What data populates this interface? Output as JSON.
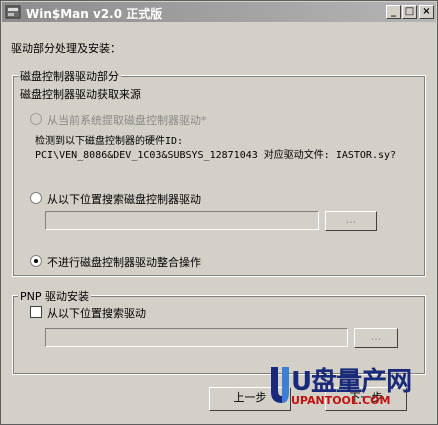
{
  "window": {
    "title": "Win$Man v2.0 正式版"
  },
  "titlebar_buttons": {
    "minimize": "_",
    "maximize": "□",
    "close": "×"
  },
  "intro": "驱动部分处理及安装：",
  "disk_group": {
    "legend": "磁盘控制器驱动部分",
    "source_label": "磁盘控制器驱动获取来源",
    "option_current": "从当前系统提取磁盘控制器驱动*",
    "detected_label": "检测到以下磁盘控制器的硬件ID:",
    "hardware_id_line": "PCI\\VEN_8086&DEV_1C03&SUBSYS_12871043 对应驱动文件: IASTOR.sy?",
    "option_search": "从以下位置搜索磁盘控制器驱动",
    "search_path_value": "",
    "browse_label": "...",
    "option_skip": "不进行磁盘控制器驱动整合操作",
    "selected_option": "option_skip"
  },
  "pnp_group": {
    "legend": "PNP 驱动安装",
    "checkbox_label": "从以下位置搜索驱动",
    "checked": false,
    "path_value": "",
    "browse_label": "..."
  },
  "footer": {
    "prev_label": "上一步",
    "next_label": "下一步"
  },
  "watermark": {
    "brand": "U盘量产网",
    "url": "UPANTOOL.COM"
  },
  "colors": {
    "titlebar": "#9a9a9a",
    "face": "#d4d0c8",
    "watermark_blue": "#1a2a7a",
    "watermark_red": "#c01010"
  }
}
